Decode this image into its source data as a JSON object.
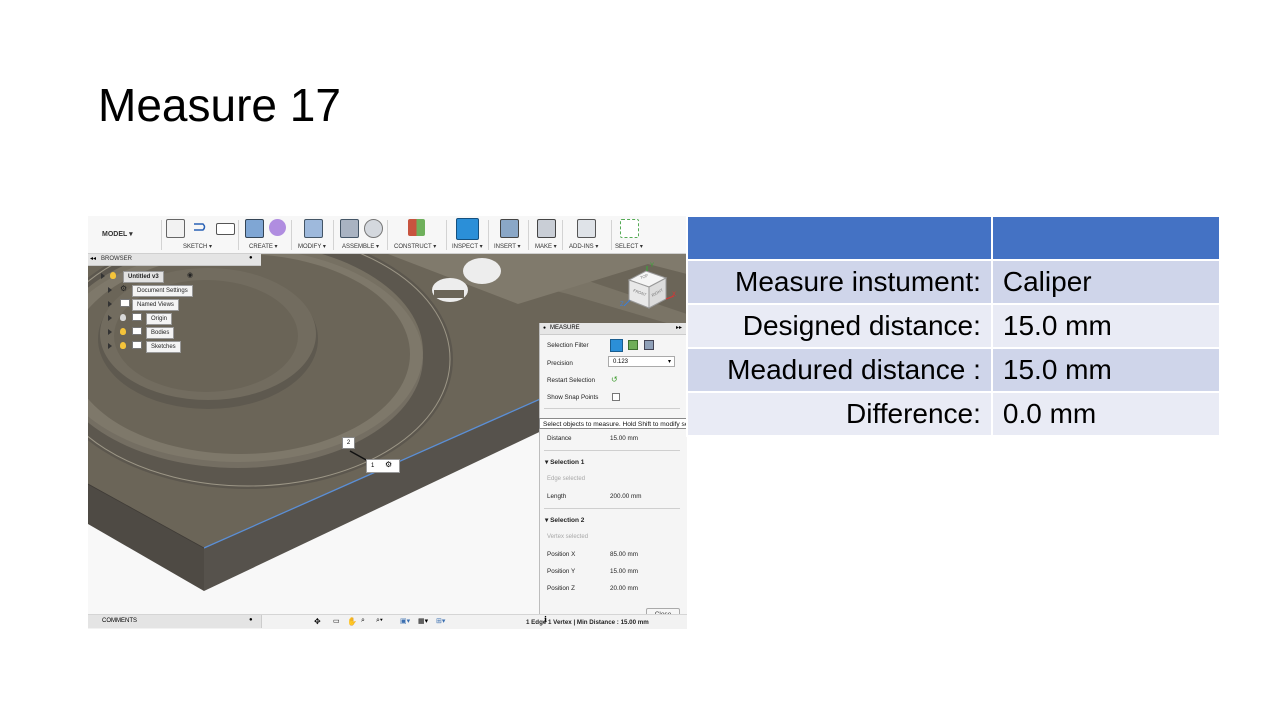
{
  "slide": {
    "title": "Measure 17"
  },
  "toolbar": {
    "model_label": "MODEL ▾",
    "groups": [
      "SKETCH ▾",
      "CREATE ▾",
      "MODIFY ▾",
      "ASSEMBLE ▾",
      "CONSTRUCT ▾",
      "INSPECT ▾",
      "INSERT ▾",
      "MAKE ▾",
      "ADD-INS ▾",
      "SELECT ▾"
    ]
  },
  "browser": {
    "title": "BROWSER",
    "items": [
      "Untitled v3",
      "Document Settings",
      "Named Views",
      "Origin",
      "Bodies",
      "Sketches"
    ]
  },
  "viewcube": {
    "front": "FRONT",
    "right": "RIGHT",
    "top": "TOP",
    "axis_x": "X",
    "axis_y": "Y",
    "axis_z": "Z"
  },
  "markers": {
    "m1": "1",
    "m2": "2"
  },
  "measure": {
    "title": "MEASURE",
    "selection_filter_label": "Selection Filter",
    "precision_label": "Precision",
    "precision_value": "0.123",
    "restart_label": "Restart Selection",
    "snap_label": "Show Snap Points",
    "tooltip": "Select objects to measure. Hold Shift to modify selection.",
    "distance_label": "Distance",
    "distance_value": "15.00 mm",
    "sel1_title": "Selection 1",
    "sel1_status": "Edge selected",
    "length_label": "Length",
    "length_value": "200.00 mm",
    "sel2_title": "Selection 2",
    "sel2_status": "Vertex selected",
    "pos_x_label": "Position X",
    "pos_x_value": "85.00 mm",
    "pos_y_label": "Position Y",
    "pos_y_value": "15.00 mm",
    "pos_z_label": "Position Z",
    "pos_z_value": "20.00 mm",
    "close_label": "Close"
  },
  "bottom": {
    "comments_label": "COMMENTS",
    "status_text": "1 Edge 1 Vertex | Min Distance : 15.00 mm"
  },
  "table": {
    "rows": [
      {
        "label": "Measure instument:",
        "value": "Caliper"
      },
      {
        "label": "Designed distance:",
        "value": "15.0 mm"
      },
      {
        "label": "Meadured distance :",
        "value": "15.0 mm"
      },
      {
        "label": "Difference:",
        "value": "0.0 mm"
      }
    ]
  },
  "colors": {
    "table_header": "#4472c4",
    "table_row_odd": "#cfd5ea",
    "table_row_even": "#e9ebf5",
    "model_surface": "#6b6558",
    "model_side": "#54504a",
    "edge_highlight": "#5b8fd6"
  }
}
